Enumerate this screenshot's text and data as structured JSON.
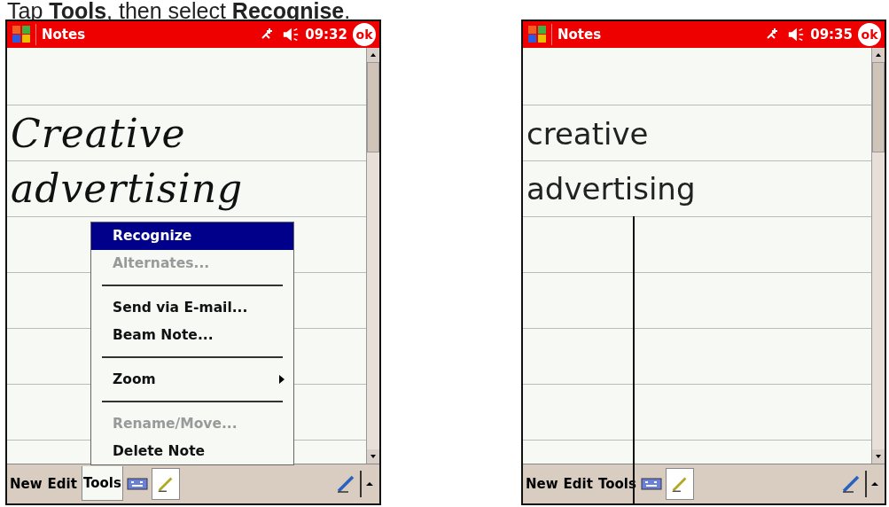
{
  "caption": "Tap **Tools**, then select **Recognise**.",
  "screens": [
    {
      "title": "Notes",
      "time": "09:32",
      "ok": "ok",
      "kind": "ink_note",
      "note_lines": [
        "Creative",
        "advertising"
      ],
      "leader_line": false,
      "menu_bar": [
        {
          "label": "New",
          "selected": false
        },
        {
          "label": "Edit",
          "selected": false
        },
        {
          "label": "Tools",
          "selected": true
        }
      ],
      "menu": [
        {
          "kind": "item",
          "label": "Recognize",
          "selected": true,
          "disabled": false
        },
        {
          "kind": "item",
          "label": "Alternates...",
          "selected": false,
          "disabled": true
        },
        {
          "kind": "separator"
        },
        {
          "kind": "item",
          "label": "Send via E-mail...",
          "selected": false,
          "disabled": false
        },
        {
          "kind": "item",
          "label": "Beam Note...",
          "selected": false,
          "disabled": false
        },
        {
          "kind": "separator"
        },
        {
          "kind": "submenu",
          "label": "Zoom",
          "selected": false,
          "disabled": false
        },
        {
          "kind": "separator"
        },
        {
          "kind": "item",
          "label": "Rename/Move...",
          "selected": false,
          "disabled": true
        },
        {
          "kind": "item",
          "label": "Delete Note",
          "selected": false,
          "disabled": false
        }
      ]
    },
    {
      "title": "Notes",
      "time": "09:35",
      "ok": "ok",
      "kind": "text_note",
      "note_lines": [
        "creative",
        "advertising"
      ],
      "leader_line": true,
      "menu_bar": [
        {
          "label": "New",
          "selected": false
        },
        {
          "label": "Edit",
          "selected": false
        },
        {
          "label": "Tools",
          "selected": false
        }
      ]
    }
  ]
}
